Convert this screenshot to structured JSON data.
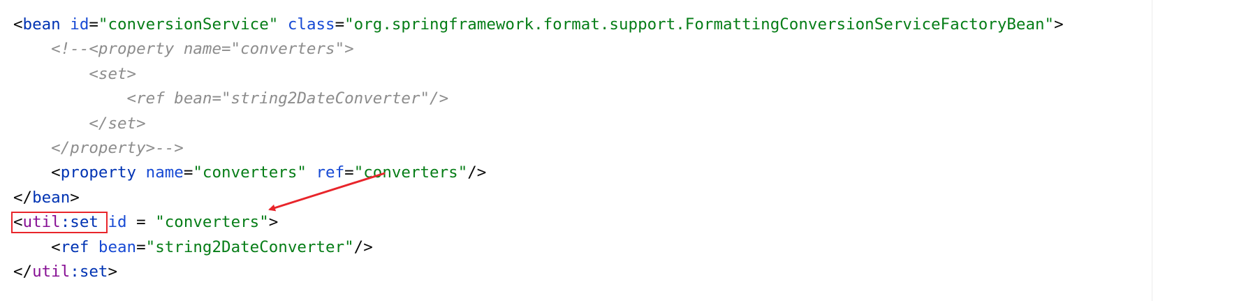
{
  "editor": {
    "lines": [
      [
        {
          "cls": "t-punc",
          "text": "<"
        },
        {
          "cls": "t-tag",
          "text": "bean "
        },
        {
          "cls": "t-attr",
          "text": "id"
        },
        {
          "cls": "t-punc",
          "text": "="
        },
        {
          "cls": "t-val",
          "text": "\"conversionService\" "
        },
        {
          "cls": "t-attr",
          "text": "class"
        },
        {
          "cls": "t-punc",
          "text": "="
        },
        {
          "cls": "t-val",
          "text": "\"org.springframework.format.support.FormattingConversionServiceFactoryBean\""
        },
        {
          "cls": "t-punc",
          "text": ">"
        }
      ],
      [
        {
          "cls": "t-comment",
          "text": "    <!--<property name=\"converters\">"
        }
      ],
      [
        {
          "cls": "t-comment",
          "text": "        <set>"
        }
      ],
      [
        {
          "cls": "t-comment",
          "text": "            <ref bean=\"string2DateConverter\"/>"
        }
      ],
      [
        {
          "cls": "t-comment",
          "text": "        </set>"
        }
      ],
      [
        {
          "cls": "t-comment",
          "text": "    </property>-->"
        }
      ],
      [
        {
          "cls": "t-punc",
          "text": "    <"
        },
        {
          "cls": "t-tag",
          "text": "property "
        },
        {
          "cls": "t-attr",
          "text": "name"
        },
        {
          "cls": "t-punc",
          "text": "="
        },
        {
          "cls": "t-val",
          "text": "\"converters\" "
        },
        {
          "cls": "t-attr",
          "text": "ref"
        },
        {
          "cls": "t-punc",
          "text": "="
        },
        {
          "cls": "t-val",
          "text": "\"converters\""
        },
        {
          "cls": "t-punc",
          "text": "/>"
        }
      ],
      [
        {
          "cls": "t-punc",
          "text": "</"
        },
        {
          "cls": "t-tag",
          "text": "bean"
        },
        {
          "cls": "t-punc",
          "text": ">"
        }
      ],
      [
        {
          "cls": "t-punc",
          "text": "<"
        },
        {
          "cls": "t-ns",
          "text": "util"
        },
        {
          "cls": "t-tag",
          "text": ":set "
        },
        {
          "cls": "t-attr",
          "text": "id"
        },
        {
          "cls": "t-punc",
          "text": " = "
        },
        {
          "cls": "t-val",
          "text": "\"converters\""
        },
        {
          "cls": "t-punc",
          "text": ">"
        }
      ],
      [
        {
          "cls": "t-punc",
          "text": "    <"
        },
        {
          "cls": "t-tag",
          "text": "ref "
        },
        {
          "cls": "t-attr",
          "text": "bean"
        },
        {
          "cls": "t-punc",
          "text": "="
        },
        {
          "cls": "t-val",
          "text": "\"string2DateConverter\""
        },
        {
          "cls": "t-punc",
          "text": "/>"
        }
      ],
      [
        {
          "cls": "t-punc",
          "text": "</"
        },
        {
          "cls": "t-ns",
          "text": "util"
        },
        {
          "cls": "t-tag",
          "text": ":set"
        },
        {
          "cls": "t-punc",
          "text": ">"
        }
      ]
    ]
  },
  "annotations": {
    "box_color": "#e8252b",
    "arrow_color": "#e8252b"
  }
}
